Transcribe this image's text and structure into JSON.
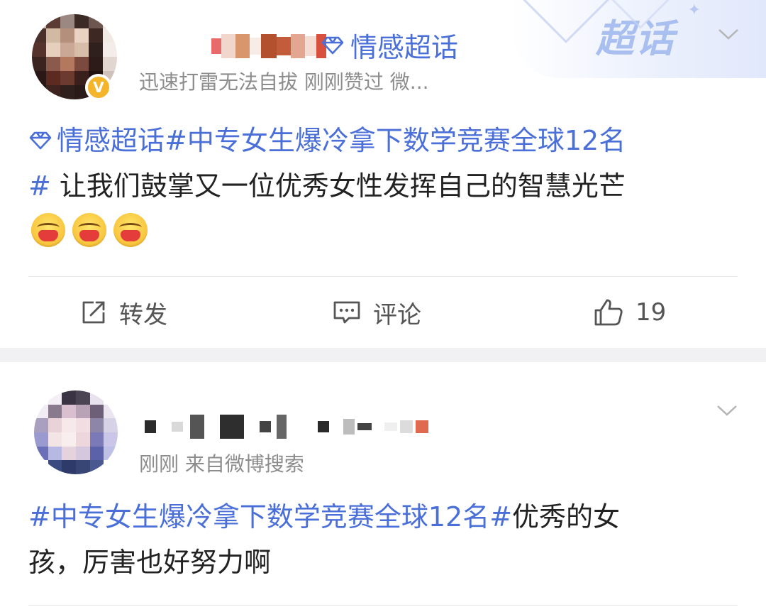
{
  "post1": {
    "topic_label": "情感超话",
    "meta": "迅速打雷无法自拔  刚刚赞过  微...",
    "corner_badge": "超话",
    "content_line1_tag": "情感超话#中专女生爆冷拿下数学竞赛全球12名",
    "content_line2_tag": "#",
    "content_line2_text": " 让我们鼓掌又一位优秀女性发挥自己的智慧光芒",
    "actions": {
      "repost_label": "转发",
      "comment_label": "评论",
      "like_count": "19"
    }
  },
  "post2": {
    "meta": "刚刚  来自微博搜索",
    "content_tag": "#中专女生爆冷拿下数学竞赛全球12名#",
    "content_text": "优秀的女",
    "content_line2": "孩，厉害也好努力啊"
  },
  "colors": {
    "link_blue": "#4a6fd8",
    "meta_gray": "#8c8c8c",
    "verified_gold": "#f5b52b",
    "separator": "#f1f1f3"
  },
  "icons": [
    "diamond-icon",
    "repost-icon",
    "comment-icon",
    "thumbs-up-icon",
    "chevron-down-icon",
    "verified-badge-icon"
  ]
}
